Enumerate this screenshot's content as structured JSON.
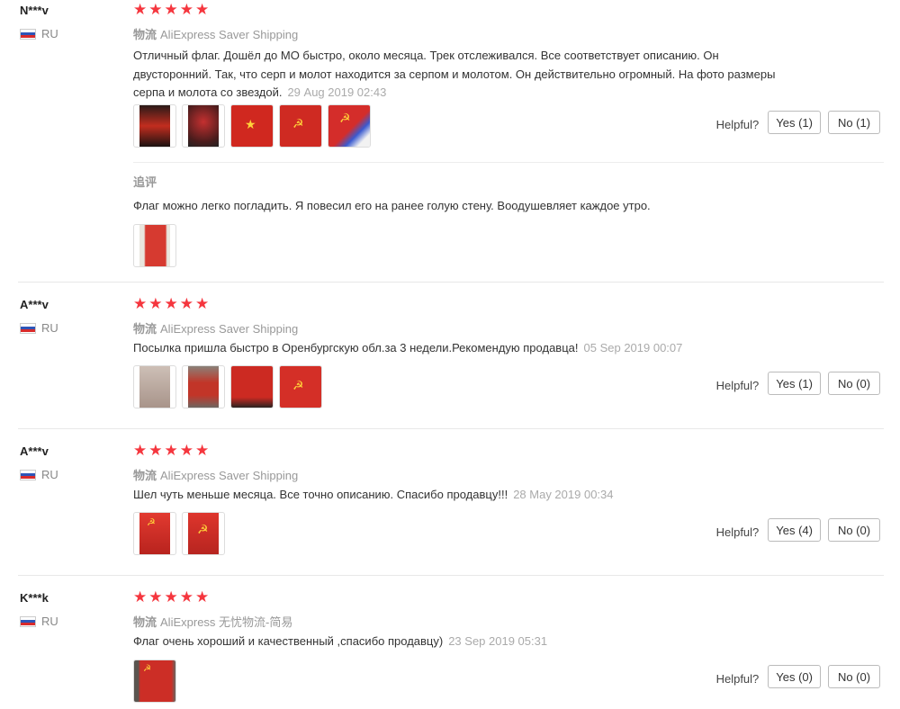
{
  "colors": {
    "star": "#f5363e",
    "flag_red": "#d92b2b",
    "flag_blue": "#2d55b8"
  },
  "helpful_label": "Helpful?",
  "reviews": [
    {
      "user": "N***v",
      "country": "RU",
      "rating": "★★★★★",
      "ship_cn": "物流",
      "ship": "AliExpress Saver Shipping",
      "text": "Отличный флаг. Дошёл до МО быстро, около месяца. Трек отслеживался. Все соответствует описанию. Он двусторонний. Так, что серп и молот находится за серпом и молотом. Он действительно огромный. На фото размеры серпа и молота со звездой.",
      "date": "29 Aug 2019 02:43",
      "yes": "Yes (1)",
      "no": "No (1)",
      "followup_title": "追评",
      "followup_text": "Флаг можно легко погладить. Я повесил его на ранее голую стену. Воодушевляет каждое утро."
    },
    {
      "user": "A***v",
      "country": "RU",
      "rating": "★★★★★",
      "ship_cn": "物流",
      "ship": "AliExpress Saver Shipping",
      "text": "Посылка пришла быстро в Оренбургскую обл.за 3 недели.Рекомендую продавца!",
      "date": "05 Sep 2019 00:07",
      "yes": "Yes (1)",
      "no": "No (0)"
    },
    {
      "user": "A***v",
      "country": "RU",
      "rating": "★★★★★",
      "ship_cn": "物流",
      "ship": "AliExpress Saver Shipping",
      "text": "Шел чуть меньше месяца. Все точно описанию. Спасибо продавцу!!!",
      "date": "28 May 2019 00:34",
      "yes": "Yes (4)",
      "no": "No (0)"
    },
    {
      "user": "K***k",
      "country": "RU",
      "rating": "★★★★★",
      "ship_cn": "物流",
      "ship": "AliExpress 无忧物流-简易",
      "text": "Флаг очень хороший и качественный ,спасибо продавцу)",
      "date": "23 Sep 2019 05:31",
      "yes": "Yes (0)",
      "no": "No (0)"
    }
  ]
}
